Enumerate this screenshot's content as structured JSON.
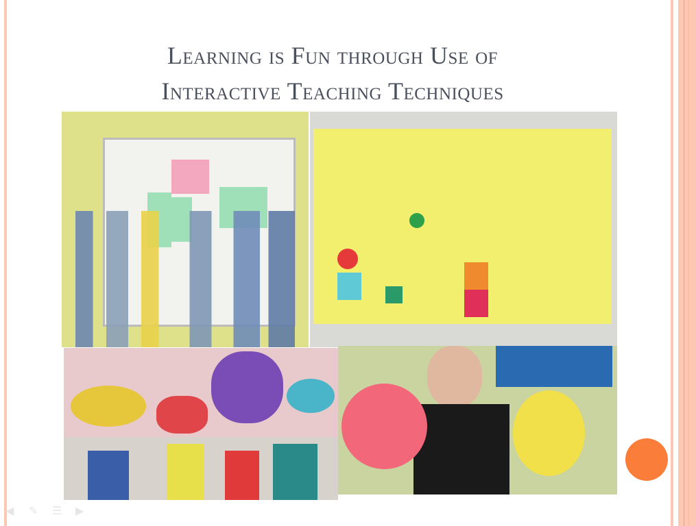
{
  "slide": {
    "title_line1": "Learning is Fun through Use of",
    "title_line2": "Interactive Teaching Techniques",
    "accent_color": "#fa7e3a",
    "border_color": "#fdc8b3"
  },
  "photos": [
    {
      "subject": "students at whiteboard"
    },
    {
      "subject": "snakes and ladders style number board game"
    },
    {
      "subject": "children holding paper fish puppets"
    },
    {
      "subject": "teacher holding fruit paper puppets"
    }
  ],
  "nav": {
    "prev_icon": "arrow-left-icon",
    "pen_icon": "pen-icon",
    "menu_icon": "menu-icon",
    "next_icon": "arrow-right-icon"
  }
}
